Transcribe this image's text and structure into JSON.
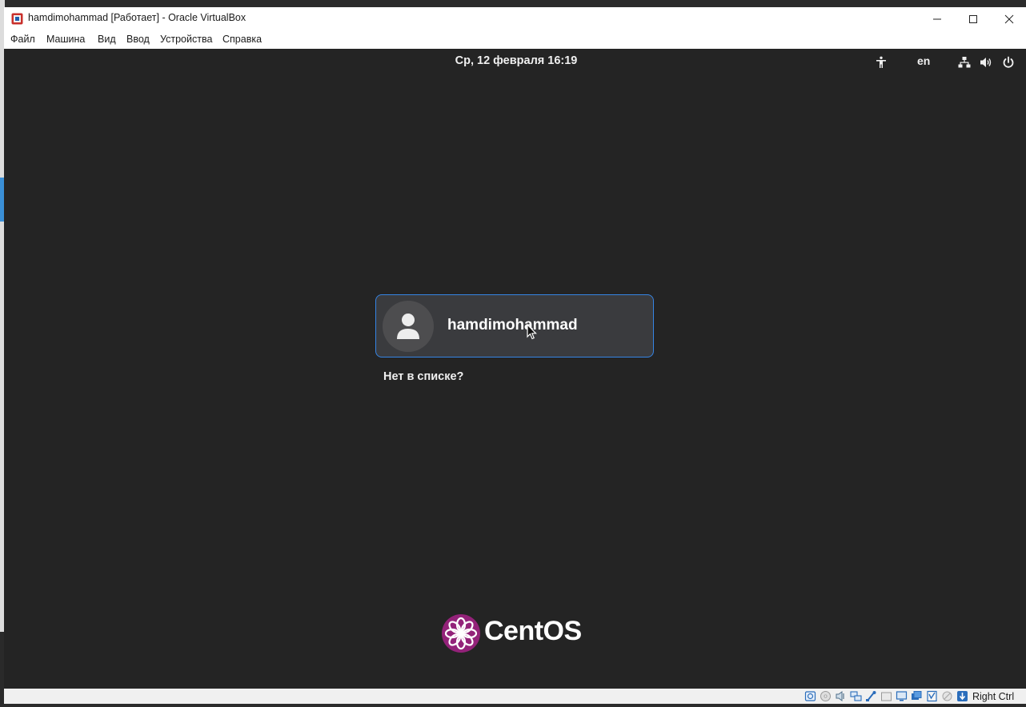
{
  "window": {
    "title": "hamdimohammad [Работает] - Oracle VirtualBox",
    "app_icon": "virtualbox-icon"
  },
  "menu": {
    "items": [
      "Файл",
      "Машина",
      "Вид",
      "Ввод",
      "Устройства",
      "Справка"
    ]
  },
  "guest": {
    "clock": "Ср, 12 февраля  16:19",
    "top_bar_icons": [
      "accessibility-icon",
      "network-icon",
      "volume-icon",
      "power-icon"
    ],
    "language": "en",
    "user": {
      "name": "hamdimohammad"
    },
    "not_listed": "Нет в списке?",
    "brand": "CentOS"
  },
  "statusbar": {
    "icons": [
      "hard-disk-icon",
      "optical-drive-icon",
      "audio-icon",
      "network-adapters-icon",
      "usb-icon",
      "shared-folders-icon",
      "display-icon",
      "video-capture-icon",
      "cpu-icon",
      "mouse-integration-icon",
      "keyboard-capture-icon"
    ],
    "host_key": "Right Ctrl"
  },
  "colors": {
    "guest_background": "#242424",
    "card_border": "#3584e4",
    "centos_purple": "#932279"
  }
}
